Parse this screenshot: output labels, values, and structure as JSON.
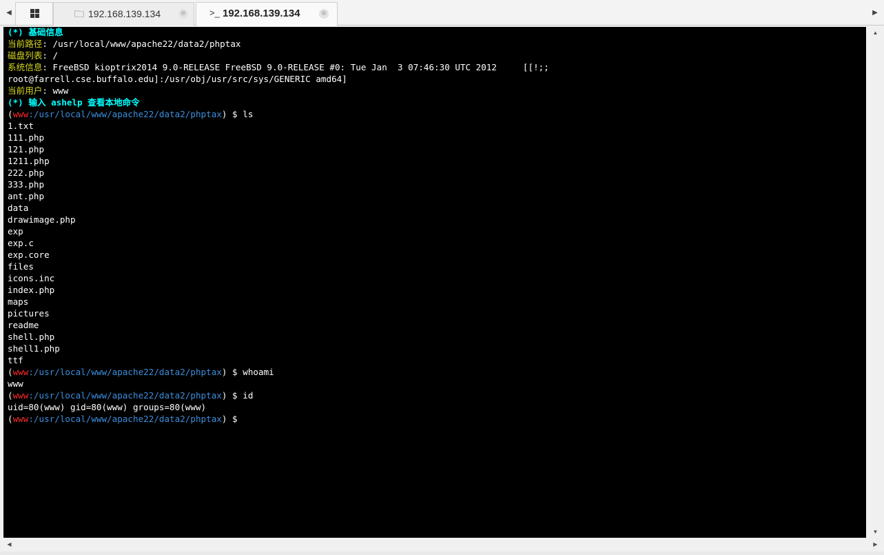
{
  "tabs": {
    "scroll_left": "◀",
    "scroll_right": "▶",
    "home_icon": "grid-icon",
    "items": [
      {
        "icon": "folder-icon",
        "icon_glyph": "🗀",
        "label": "192.168.139.134",
        "close": "⊗",
        "active": false
      },
      {
        "icon": "terminal-icon",
        "icon_glyph": ">_",
        "label": "192.168.139.134",
        "close": "⊗",
        "active": true
      }
    ]
  },
  "terminal": {
    "colors": {
      "background": "#000000",
      "text": "#ffffff",
      "header": "#00ffff",
      "label": "#d6d623",
      "user": "#ff2a2a",
      "path": "#3c8fdc"
    },
    "header_basic": "(*) 基础信息",
    "info": {
      "path_label": "当前路径",
      "path_value": ": /usr/local/www/apache22/data2/phptax",
      "disk_label": "磁盘列表",
      "disk_value": ": /",
      "sys_label": "系统信息",
      "sys_value": ": FreeBSD kioptrix2014 9.0-RELEASE FreeBSD 9.0-RELEASE #0: Tue Jan  3 07:46:30 UTC 2012     [[!;;",
      "sys_value_cont": "root@farrell.cse.buffalo.edu]:/usr/obj/usr/src/sys/GENERIC amd64]",
      "user_label": "当前用户",
      "user_value": ": www"
    },
    "header_help": "(*) 输入 ashelp 查看本地命令",
    "prompt": {
      "open": "(",
      "user": "www",
      "path": ":/usr/local/www/apache22/data2/phptax",
      "close": ") $ "
    },
    "commands": {
      "cmd1": "ls",
      "cmd2": "whoami",
      "cmd3": "id",
      "cmd4": ""
    },
    "ls_output": [
      "1.txt",
      "111.php",
      "121.php",
      "1211.php",
      "222.php",
      "333.php",
      "ant.php",
      "data",
      "drawimage.php",
      "exp",
      "exp.c",
      "exp.core",
      "files",
      "icons.inc",
      "index.php",
      "maps",
      "pictures",
      "readme",
      "shell.php",
      "shell1.php",
      "ttf"
    ],
    "whoami_output": "www",
    "id_output": "uid=80(www) gid=80(www) groups=80(www)"
  },
  "scrollbars": {
    "up": "▲",
    "down": "▼",
    "left": "◀",
    "right": "▶"
  }
}
